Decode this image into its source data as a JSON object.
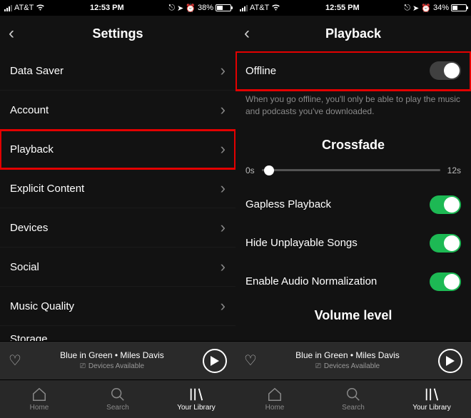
{
  "left": {
    "status": {
      "carrier": "AT&T",
      "time": "12:53 PM",
      "battery_pct": "38%",
      "battery_fill": 38
    },
    "title": "Settings",
    "rows": [
      {
        "label": "Data Saver"
      },
      {
        "label": "Account"
      },
      {
        "label": "Playback",
        "highlight": true
      },
      {
        "label": "Explicit Content"
      },
      {
        "label": "Devices"
      },
      {
        "label": "Social"
      },
      {
        "label": "Music Quality"
      },
      {
        "label": "Storage"
      }
    ]
  },
  "right": {
    "status": {
      "carrier": "AT&T",
      "time": "12:55 PM",
      "battery_pct": "34%",
      "battery_fill": 34
    },
    "title": "Playback",
    "offline": {
      "label": "Offline",
      "desc": "When you go offline, you'll only be able to play the music and podcasts you've downloaded."
    },
    "crossfade": {
      "heading": "Crossfade",
      "min": "0s",
      "max": "12s",
      "value_pct": 4
    },
    "toggles": [
      {
        "label": "Gapless Playback",
        "on": true
      },
      {
        "label": "Hide Unplayable Songs",
        "on": true
      },
      {
        "label": "Enable Audio Normalization",
        "on": true
      }
    ],
    "volume_heading": "Volume level"
  },
  "now_playing": {
    "track": "Blue in Green",
    "artist": "Miles Davis",
    "sep": " • ",
    "devices": "Devices Available"
  },
  "tabs": [
    {
      "label": "Home"
    },
    {
      "label": "Search"
    },
    {
      "label": "Your Library",
      "active": true
    }
  ]
}
